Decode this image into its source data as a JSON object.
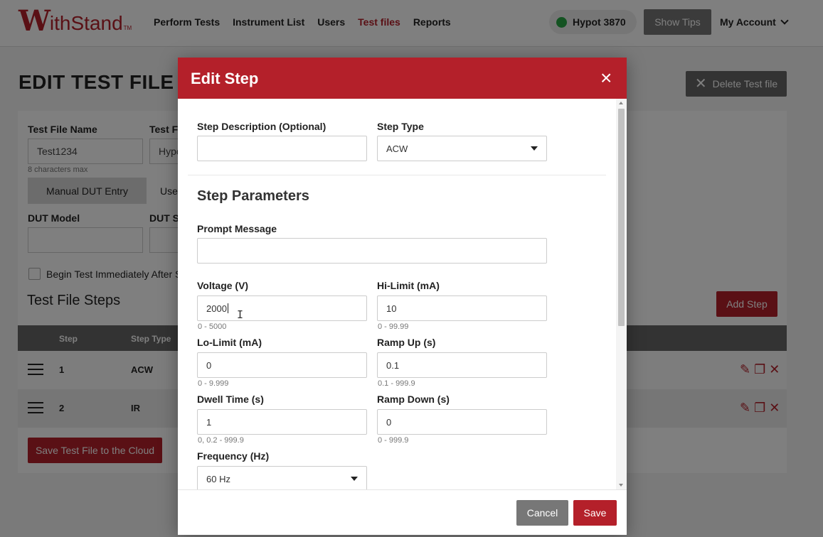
{
  "brand": {
    "logo_w": "W",
    "logo_rest": "ithStand",
    "logo_tm": "TM",
    "accent": "#b4202a"
  },
  "nav": {
    "items": [
      {
        "label": "Perform Tests"
      },
      {
        "label": "Instrument List"
      },
      {
        "label": "Users"
      },
      {
        "label": "Test files"
      },
      {
        "label": "Reports"
      }
    ],
    "active": "Test files",
    "instrument": "Hypot 3870",
    "instrument_status_color": "#28a745",
    "show_tips": "Show Tips",
    "account": "My Account"
  },
  "page": {
    "title": "EDIT TEST FILE",
    "delete_label": "Delete Test file"
  },
  "form": {
    "test_file_name_label": "Test File Name",
    "test_file_name_value": "Test1234",
    "test_file_name_hint": "8 characters max",
    "test_file_type_label": "Test Fi",
    "test_file_type_value": "Hypo",
    "manual_entry": "Manual DUT Entry",
    "use_label": "Use",
    "dut_model_label": "DUT Model",
    "dut_serial_label": "DUT Se",
    "begin_label": "Begin Test Immediately After Sc"
  },
  "steps": {
    "heading": "Test File Steps",
    "add_label": "Add Step",
    "columns": {
      "step": "Step",
      "type": "Step Type"
    },
    "rows": [
      {
        "step": "1",
        "type": "ACW"
      },
      {
        "step": "2",
        "type": "IR"
      }
    ],
    "save_cloud": "Save Test File to the Cloud"
  },
  "modal": {
    "title": "Edit Step",
    "close": "×",
    "step_description_label": "Step Description (Optional)",
    "step_description_value": "",
    "step_type_label": "Step Type",
    "step_type_value": "ACW",
    "section_title": "Step Parameters",
    "prompt_label": "Prompt Message",
    "prompt_value": "",
    "fields": {
      "voltage": {
        "label": "Voltage (V)",
        "value": "2000",
        "hint": "0 - 5000"
      },
      "hi_limit": {
        "label": "Hi-Limit (mA)",
        "value": "10",
        "hint": "0 - 99.99"
      },
      "lo_limit": {
        "label": "Lo-Limit (mA)",
        "value": "0",
        "hint": "0 - 9.999"
      },
      "ramp_up": {
        "label": "Ramp Up (s)",
        "value": "0.1",
        "hint": "0.1 - 999.9"
      },
      "dwell": {
        "label": "Dwell Time (s)",
        "value": "1",
        "hint": "0, 0.2 - 999.9"
      },
      "ramp_down": {
        "label": "Ramp Down (s)",
        "value": "0",
        "hint": "0 - 999.9"
      },
      "frequency": {
        "label": "Frequency (Hz)",
        "value": "60 Hz"
      }
    },
    "cancel": "Cancel",
    "save": "Save"
  }
}
